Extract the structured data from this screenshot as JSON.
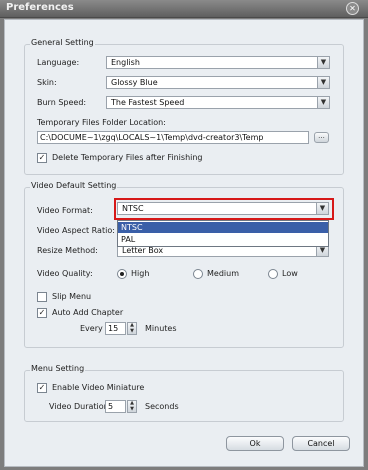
{
  "window": {
    "title": "Preferences"
  },
  "general": {
    "legend": "General Setting",
    "language_label": "Language:",
    "language_value": "English",
    "skin_label": "Skin:",
    "skin_value": "Glossy Blue",
    "burn_label": "Burn Speed:",
    "burn_value": "The Fastest Speed",
    "temp_label": "Temporary Files Folder Location:",
    "temp_value": "C:\\DOCUME~1\\zgq\\LOCALS~1\\Temp\\dvd-creator3\\Temp",
    "browse_label": "...",
    "delete_label": "Delete Temporary Files after Finishing",
    "delete_checked": true
  },
  "video": {
    "legend": "Video Default Setting",
    "format_label": "Video Format:",
    "format_value": "NTSC",
    "format_options": [
      "NTSC",
      "PAL"
    ],
    "aspect_label": "Video Aspect Ratio:",
    "resize_label": "Resize Method:",
    "resize_value": "Letter Box",
    "quality_label": "Video Quality:",
    "quality_options": [
      "High",
      "Medium",
      "Low"
    ],
    "quality_selected": "High",
    "slip_label": "Slip Menu",
    "slip_checked": false,
    "auto_label": "Auto Add Chapter",
    "auto_checked": true,
    "every_label": "Every",
    "every_value": "15",
    "minutes_label": "Minutes"
  },
  "menu": {
    "legend": "Menu Setting",
    "miniature_label": "Enable Video Miniature",
    "miniature_checked": true,
    "duration_label": "Video Duration",
    "duration_value": "5",
    "seconds_label": "Seconds"
  },
  "buttons": {
    "ok": "Ok",
    "cancel": "Cancel"
  },
  "icons": {
    "close": "close-icon",
    "dropdown": "chevron-down-icon",
    "spin_up": "triangle-up-icon",
    "spin_down": "triangle-down-icon",
    "check": "checkmark-icon"
  },
  "colors": {
    "highlight": "#d61818",
    "selection": "#3a5fa8",
    "titlebar": "#6e6e6e"
  }
}
